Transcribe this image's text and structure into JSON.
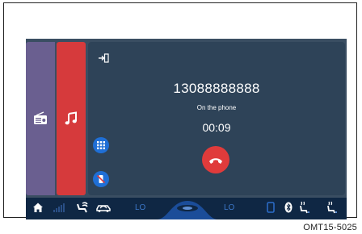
{
  "call": {
    "number": "13088888888",
    "status": "On the phone",
    "timer": "00:09"
  },
  "sidebar": {
    "tabs": [
      {
        "name": "radio",
        "icon": "radio-icon",
        "color": "#6a5f90"
      },
      {
        "name": "music",
        "icon": "music-note-icon",
        "color": "#d63a3c"
      }
    ]
  },
  "statusbar": {
    "left_climate": "LO",
    "right_climate": "LO",
    "icons": [
      "home-icon",
      "signal-icon",
      "seat-fan-icon",
      "car-recirculation-icon",
      "fan-icon",
      "phone-icon",
      "bluetooth-icon",
      "seat-heat-left-icon",
      "seat-heat-right-icon"
    ]
  },
  "colors": {
    "screen_bg": "#3a4e62",
    "panel_bg": "#2e4358",
    "statusbar_bg": "#0f2744",
    "accent_blue": "#1f6fd6",
    "hangup_red": "#e03b3b"
  },
  "caption": "OMT15-5025"
}
